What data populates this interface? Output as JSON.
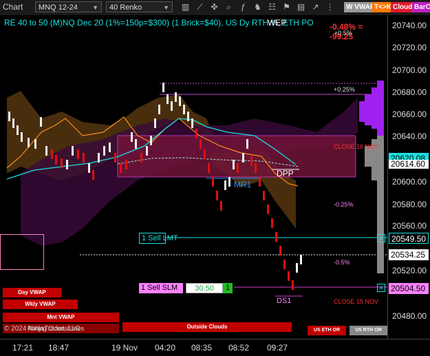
{
  "toolbar": {
    "title": "Chart",
    "instrument": "MNQ 12-24",
    "bar_type": "40 Renko",
    "buttons": {
      "wvwap": "W VWAP",
      "tk": "T<>K",
      "cloud": "Cloud",
      "barcolor": "BarCo"
    }
  },
  "header": {
    "text": "RE 40 to 50 (M)NQ Dec 20 (1%=150p=$300) (1 Brick=$40), US Dy RTH %, ETH PO",
    "overlap": "WEP",
    "change": "-0.48% = -99.25",
    "change_pct_top": "+0.5%"
  },
  "levels": {
    "plus025": "+0.25%",
    "close16": "CLOSE 16 NOV",
    "dpp": "DPP",
    "mr1": "MR1",
    "minus025": "-0.25%",
    "minus05": "-0.5%",
    "ds1": "DS1",
    "close15": "CLOSE 15 NOV"
  },
  "orders": {
    "lmt_label": "1 Sell LMT",
    "slm_label": "1 Sell SLM",
    "slm_price": "30.50",
    "slm_qty": "1"
  },
  "legend": {
    "day_vwap": "Day VWAP",
    "wkly_vwap": "Wkly VWAP",
    "mnt_vwap": "Mnt VWAP",
    "outside_clouds": "Outside Clouds",
    "us_eth": "US ETH OR",
    "us_rth": "US RTH OR",
    "copyright": "© 2024 NinjaTrader, LLC",
    "watermark": "Rolling Clouds/Lines"
  },
  "yaxis": {
    "ticks": [
      "20740.00",
      "20720.00",
      "20700.00",
      "20680.00",
      "20660.00",
      "20640.00",
      "20600.00",
      "20580.00",
      "20560.00",
      "20520.00",
      "20480.00"
    ],
    "flags": {
      "cyan_a": "20620.08",
      "cyan_b": "20614.60",
      "lmt": "20549.50",
      "last": "20534.25",
      "slm": "20504.50"
    }
  },
  "xaxis": {
    "ticks": [
      "17:21",
      "18:47",
      "19 Nov",
      "04:20",
      "08:35",
      "08:52",
      "09:27"
    ]
  },
  "colors": {
    "accent_cyan": "#19e0e0",
    "magenta": "#d040d0",
    "red_bar": "#e01010",
    "vwap_orange": "#ff8c1a"
  }
}
